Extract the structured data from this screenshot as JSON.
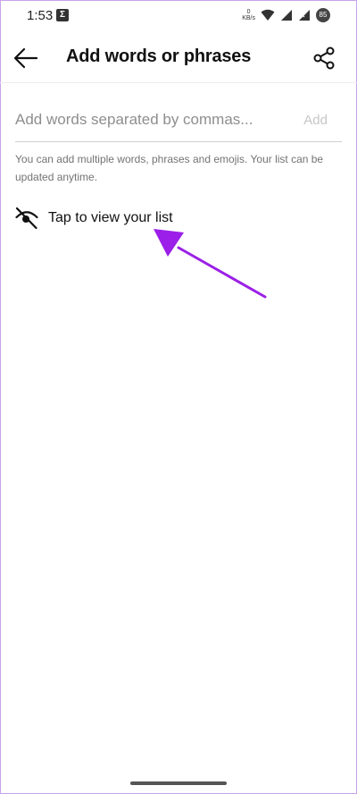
{
  "status_bar": {
    "time": "1:53",
    "app_icon_glyph": "Σ",
    "net_speed_value": "0",
    "net_speed_unit": "KB/s",
    "battery_text": "85"
  },
  "app_bar": {
    "title": "Add words or phrases",
    "back_icon": "arrow-left-icon",
    "share_icon": "share-icon"
  },
  "input": {
    "placeholder": "Add words separated by commas...",
    "value": "",
    "add_label": "Add"
  },
  "helper_text": "You can add multiple words, phrases and emojis. Your list can be updated anytime.",
  "view_list": {
    "label": "Tap to view your list",
    "icon": "eye-off-icon"
  },
  "colors": {
    "annotation_arrow": "#9b1fe8",
    "frame_border": "#c9a3e8",
    "add_disabled": "#c6c6c6"
  }
}
